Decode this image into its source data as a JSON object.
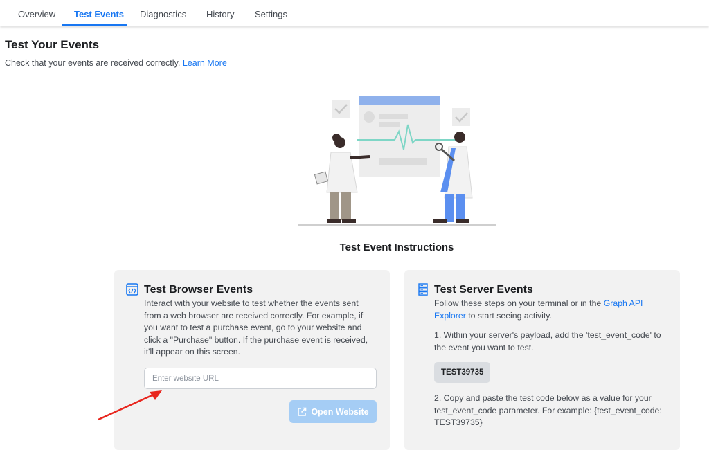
{
  "tabs": [
    {
      "label": "Overview"
    },
    {
      "label": "Test Events"
    },
    {
      "label": "Diagnostics"
    },
    {
      "label": "History"
    },
    {
      "label": "Settings"
    }
  ],
  "header": {
    "title": "Test Your Events",
    "subtitle": "Check that your events are received correctly.",
    "learn_more": "Learn More"
  },
  "instructions_title": "Test Event Instructions",
  "browser_card": {
    "icon": "code-window-icon",
    "title": "Test Browser Events",
    "lines": [
      "Interact with your website to test whether the events sent",
      "from a web browser are received correctly. For example, if",
      "you want to test a purchase event, go to your website and",
      "click a \"Purchase\" button. If the purchase event is received,",
      "it'll appear on this screen."
    ],
    "url_placeholder": "Enter website URL",
    "open_button": "Open Website"
  },
  "server_card": {
    "icon": "server-icon",
    "title": "Test Server Events",
    "intro_before": "Follow these steps on your terminal or in the",
    "intro_link_1": "Graph API",
    "intro_link_2": "Explorer",
    "intro_after": "to start seeing activity.",
    "step1_line1": "1. Within your server's payload, add the 'test_event_code' to",
    "step1_line2": "the event you want to test.",
    "code": "TEST39735",
    "step2_line1": "2. Copy and paste the test code below as a value for your",
    "step2_line2": "test_event_code parameter. For example: {test_event_code:",
    "step2_line3": "TEST39735}"
  },
  "colors": {
    "accent": "#1877f2",
    "card_bg": "#f2f2f2",
    "button_disabled": "#a5cdf5",
    "arrow": "#e8261e"
  }
}
